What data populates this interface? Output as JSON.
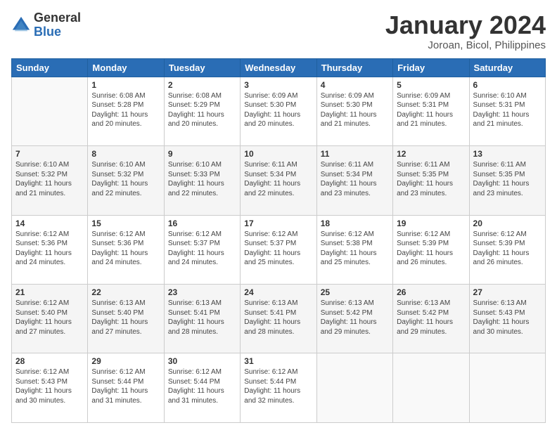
{
  "logo": {
    "general": "General",
    "blue": "Blue"
  },
  "title": {
    "month_year": "January 2024",
    "location": "Joroan, Bicol, Philippines"
  },
  "days": [
    "Sunday",
    "Monday",
    "Tuesday",
    "Wednesday",
    "Thursday",
    "Friday",
    "Saturday"
  ],
  "weeks": [
    [
      {
        "date": "",
        "sunrise": "",
        "sunset": "",
        "daylight": "",
        "empty": true
      },
      {
        "date": "1",
        "sunrise": "Sunrise: 6:08 AM",
        "sunset": "Sunset: 5:28 PM",
        "daylight": "Daylight: 11 hours and 20 minutes."
      },
      {
        "date": "2",
        "sunrise": "Sunrise: 6:08 AM",
        "sunset": "Sunset: 5:29 PM",
        "daylight": "Daylight: 11 hours and 20 minutes."
      },
      {
        "date": "3",
        "sunrise": "Sunrise: 6:09 AM",
        "sunset": "Sunset: 5:30 PM",
        "daylight": "Daylight: 11 hours and 20 minutes."
      },
      {
        "date": "4",
        "sunrise": "Sunrise: 6:09 AM",
        "sunset": "Sunset: 5:30 PM",
        "daylight": "Daylight: 11 hours and 21 minutes."
      },
      {
        "date": "5",
        "sunrise": "Sunrise: 6:09 AM",
        "sunset": "Sunset: 5:31 PM",
        "daylight": "Daylight: 11 hours and 21 minutes."
      },
      {
        "date": "6",
        "sunrise": "Sunrise: 6:10 AM",
        "sunset": "Sunset: 5:31 PM",
        "daylight": "Daylight: 11 hours and 21 minutes."
      }
    ],
    [
      {
        "date": "7",
        "sunrise": "Sunrise: 6:10 AM",
        "sunset": "Sunset: 5:32 PM",
        "daylight": "Daylight: 11 hours and 21 minutes."
      },
      {
        "date": "8",
        "sunrise": "Sunrise: 6:10 AM",
        "sunset": "Sunset: 5:32 PM",
        "daylight": "Daylight: 11 hours and 22 minutes."
      },
      {
        "date": "9",
        "sunrise": "Sunrise: 6:10 AM",
        "sunset": "Sunset: 5:33 PM",
        "daylight": "Daylight: 11 hours and 22 minutes."
      },
      {
        "date": "10",
        "sunrise": "Sunrise: 6:11 AM",
        "sunset": "Sunset: 5:34 PM",
        "daylight": "Daylight: 11 hours and 22 minutes."
      },
      {
        "date": "11",
        "sunrise": "Sunrise: 6:11 AM",
        "sunset": "Sunset: 5:34 PM",
        "daylight": "Daylight: 11 hours and 23 minutes."
      },
      {
        "date": "12",
        "sunrise": "Sunrise: 6:11 AM",
        "sunset": "Sunset: 5:35 PM",
        "daylight": "Daylight: 11 hours and 23 minutes."
      },
      {
        "date": "13",
        "sunrise": "Sunrise: 6:11 AM",
        "sunset": "Sunset: 5:35 PM",
        "daylight": "Daylight: 11 hours and 23 minutes."
      }
    ],
    [
      {
        "date": "14",
        "sunrise": "Sunrise: 6:12 AM",
        "sunset": "Sunset: 5:36 PM",
        "daylight": "Daylight: 11 hours and 24 minutes."
      },
      {
        "date": "15",
        "sunrise": "Sunrise: 6:12 AM",
        "sunset": "Sunset: 5:36 PM",
        "daylight": "Daylight: 11 hours and 24 minutes."
      },
      {
        "date": "16",
        "sunrise": "Sunrise: 6:12 AM",
        "sunset": "Sunset: 5:37 PM",
        "daylight": "Daylight: 11 hours and 24 minutes."
      },
      {
        "date": "17",
        "sunrise": "Sunrise: 6:12 AM",
        "sunset": "Sunset: 5:37 PM",
        "daylight": "Daylight: 11 hours and 25 minutes."
      },
      {
        "date": "18",
        "sunrise": "Sunrise: 6:12 AM",
        "sunset": "Sunset: 5:38 PM",
        "daylight": "Daylight: 11 hours and 25 minutes."
      },
      {
        "date": "19",
        "sunrise": "Sunrise: 6:12 AM",
        "sunset": "Sunset: 5:39 PM",
        "daylight": "Daylight: 11 hours and 26 minutes."
      },
      {
        "date": "20",
        "sunrise": "Sunrise: 6:12 AM",
        "sunset": "Sunset: 5:39 PM",
        "daylight": "Daylight: 11 hours and 26 minutes."
      }
    ],
    [
      {
        "date": "21",
        "sunrise": "Sunrise: 6:12 AM",
        "sunset": "Sunset: 5:40 PM",
        "daylight": "Daylight: 11 hours and 27 minutes."
      },
      {
        "date": "22",
        "sunrise": "Sunrise: 6:13 AM",
        "sunset": "Sunset: 5:40 PM",
        "daylight": "Daylight: 11 hours and 27 minutes."
      },
      {
        "date": "23",
        "sunrise": "Sunrise: 6:13 AM",
        "sunset": "Sunset: 5:41 PM",
        "daylight": "Daylight: 11 hours and 28 minutes."
      },
      {
        "date": "24",
        "sunrise": "Sunrise: 6:13 AM",
        "sunset": "Sunset: 5:41 PM",
        "daylight": "Daylight: 11 hours and 28 minutes."
      },
      {
        "date": "25",
        "sunrise": "Sunrise: 6:13 AM",
        "sunset": "Sunset: 5:42 PM",
        "daylight": "Daylight: 11 hours and 29 minutes."
      },
      {
        "date": "26",
        "sunrise": "Sunrise: 6:13 AM",
        "sunset": "Sunset: 5:42 PM",
        "daylight": "Daylight: 11 hours and 29 minutes."
      },
      {
        "date": "27",
        "sunrise": "Sunrise: 6:13 AM",
        "sunset": "Sunset: 5:43 PM",
        "daylight": "Daylight: 11 hours and 30 minutes."
      }
    ],
    [
      {
        "date": "28",
        "sunrise": "Sunrise: 6:12 AM",
        "sunset": "Sunset: 5:43 PM",
        "daylight": "Daylight: 11 hours and 30 minutes."
      },
      {
        "date": "29",
        "sunrise": "Sunrise: 6:12 AM",
        "sunset": "Sunset: 5:44 PM",
        "daylight": "Daylight: 11 hours and 31 minutes."
      },
      {
        "date": "30",
        "sunrise": "Sunrise: 6:12 AM",
        "sunset": "Sunset: 5:44 PM",
        "daylight": "Daylight: 11 hours and 31 minutes."
      },
      {
        "date": "31",
        "sunrise": "Sunrise: 6:12 AM",
        "sunset": "Sunset: 5:44 PM",
        "daylight": "Daylight: 11 hours and 32 minutes."
      },
      {
        "date": "",
        "sunrise": "",
        "sunset": "",
        "daylight": "",
        "empty": true
      },
      {
        "date": "",
        "sunrise": "",
        "sunset": "",
        "daylight": "",
        "empty": true
      },
      {
        "date": "",
        "sunrise": "",
        "sunset": "",
        "daylight": "",
        "empty": true
      }
    ]
  ]
}
